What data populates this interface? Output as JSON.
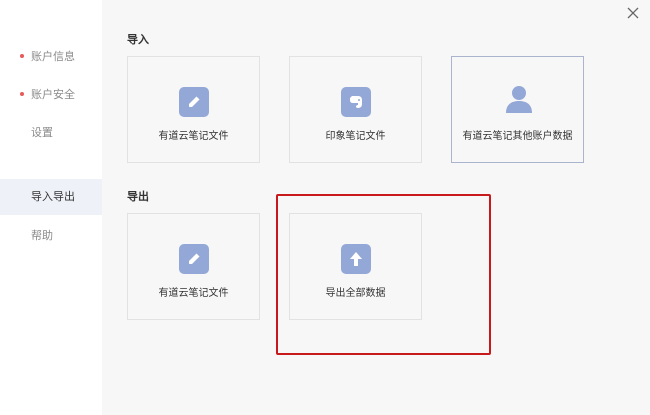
{
  "sidebar": {
    "items": [
      {
        "label": "账户信息",
        "dot": true
      },
      {
        "label": "账户安全",
        "dot": true
      },
      {
        "label": "设置",
        "dot": false
      },
      {
        "label": "导入导出",
        "active": true
      },
      {
        "label": "帮助",
        "dot": false
      }
    ]
  },
  "import": {
    "title": "导入",
    "cards": [
      {
        "label": "有道云笔记文件",
        "icon": "pencil-icon"
      },
      {
        "label": "印象笔记文件",
        "icon": "evernote-icon"
      },
      {
        "label": "有道云笔记其他账户数据",
        "icon": "user-icon"
      }
    ]
  },
  "export": {
    "title": "导出",
    "cards": [
      {
        "label": "有道云笔记文件",
        "icon": "pencil-icon"
      },
      {
        "label": "导出全部数据",
        "icon": "upload-arrow-icon"
      }
    ]
  },
  "colors": {
    "icon_bg": "#93a8d6",
    "highlight": "#c8191c",
    "dot": "#e65a5a"
  }
}
